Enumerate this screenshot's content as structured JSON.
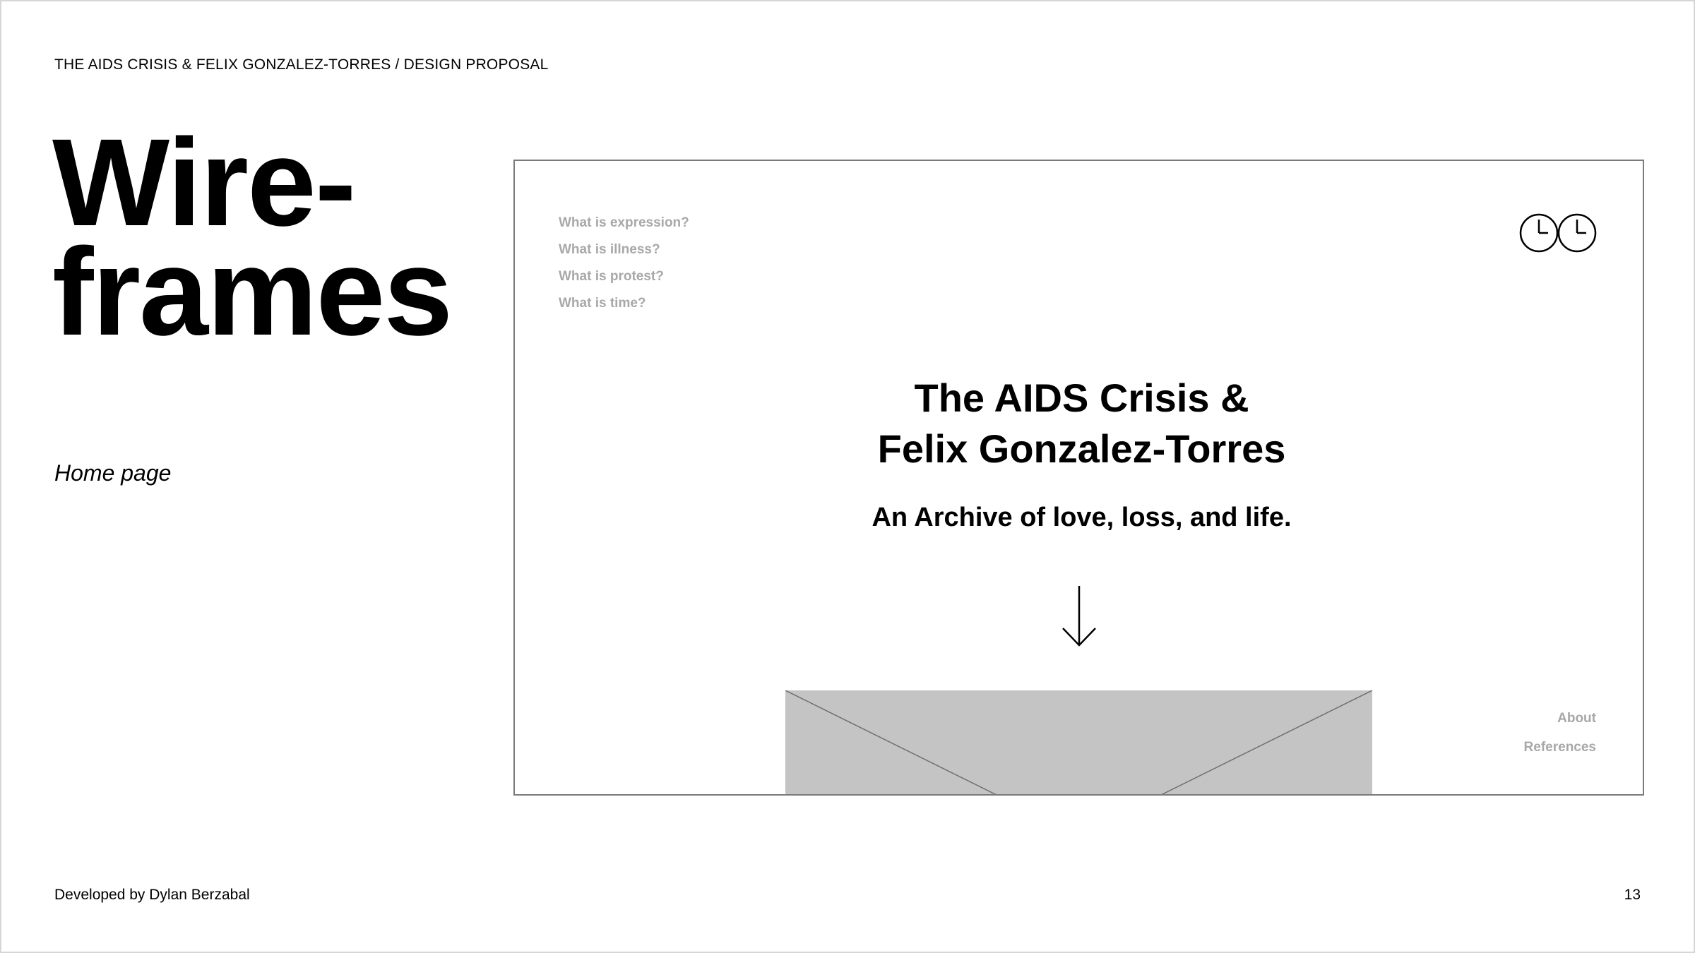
{
  "header": {
    "breadcrumb": "THE AIDS CRISIS & FELIX GONZALEZ-TORRES / DESIGN PROPOSAL"
  },
  "title": {
    "line1": "Wire-",
    "line2": "frames"
  },
  "subtitle": "Home page",
  "wireframe": {
    "nav_items": [
      {
        "label": "What is expression?"
      },
      {
        "label": "What is illness?"
      },
      {
        "label": "What is protest?"
      },
      {
        "label": "What is time?"
      }
    ],
    "logo_icon": "two-clocks-icon",
    "heading_line1": "The AIDS Crisis &",
    "heading_line2": "Felix Gonzalez-Torres",
    "tagline": "An Archive of love, loss, and life.",
    "arrow_icon": "arrow-down-icon",
    "image_placeholder_color": "#c4c4c4",
    "footer_links": [
      {
        "label": "About"
      },
      {
        "label": "References"
      }
    ]
  },
  "footer": {
    "credit": "Developed by Dylan Berzabal",
    "page_number": "13"
  }
}
